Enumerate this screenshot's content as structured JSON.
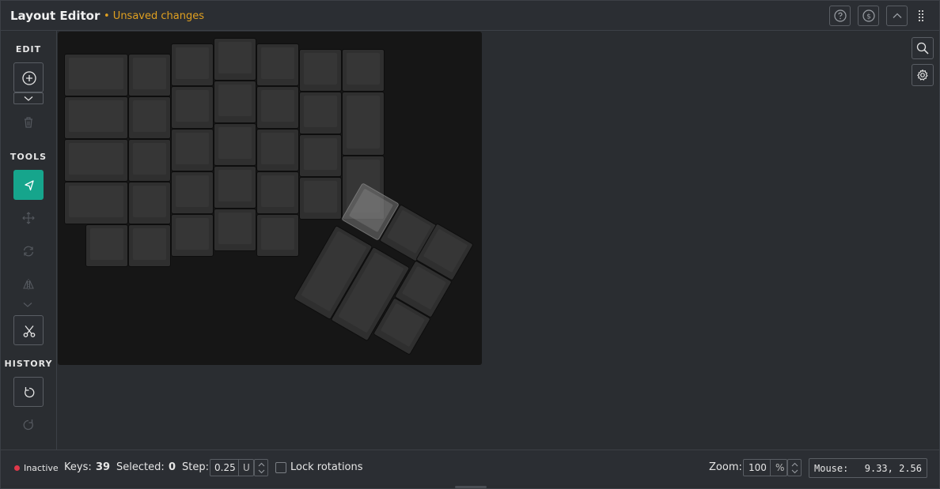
{
  "header": {
    "title": "Layout Editor",
    "unsaved": "• Unsaved changes",
    "buttons": [
      "help-icon",
      "coin-icon",
      "chevron-up-icon",
      "drag-handle-icon"
    ]
  },
  "toolbar": {
    "edit_label": "EDIT",
    "tools_label": "TOOLS",
    "history_label": "HISTORY",
    "icons": [
      "add-key-icon",
      "chevron-down-icon",
      "trash-icon",
      "select-pointer-icon",
      "move-icon",
      "rotate-icon",
      "mirror-icon",
      "chevron-down-icon",
      "cut-tool-icon",
      "undo-icon",
      "redo-icon"
    ]
  },
  "right_controls": [
    "search-icon",
    "gear-icon"
  ],
  "status": {
    "state": "Inactive",
    "keys_label": "Keys:",
    "keys_value": "39",
    "selected_label": "Selected:",
    "selected_value": "0",
    "step_label": "Step:",
    "step_value": "0.25",
    "step_unit": "U",
    "lock_rotations": "Lock rotations",
    "zoom_label": "Zoom:",
    "zoom_value": "100",
    "zoom_unit": "%",
    "mouse_label": "Mouse:",
    "mouse_value": "9.33, 2.56"
  },
  "colors": {
    "accent": "#16a58c",
    "warning": "#e0a020",
    "inactive_dot": "#e0384a",
    "canvas_bg": "#161616",
    "key": "#2f2f2f"
  }
}
